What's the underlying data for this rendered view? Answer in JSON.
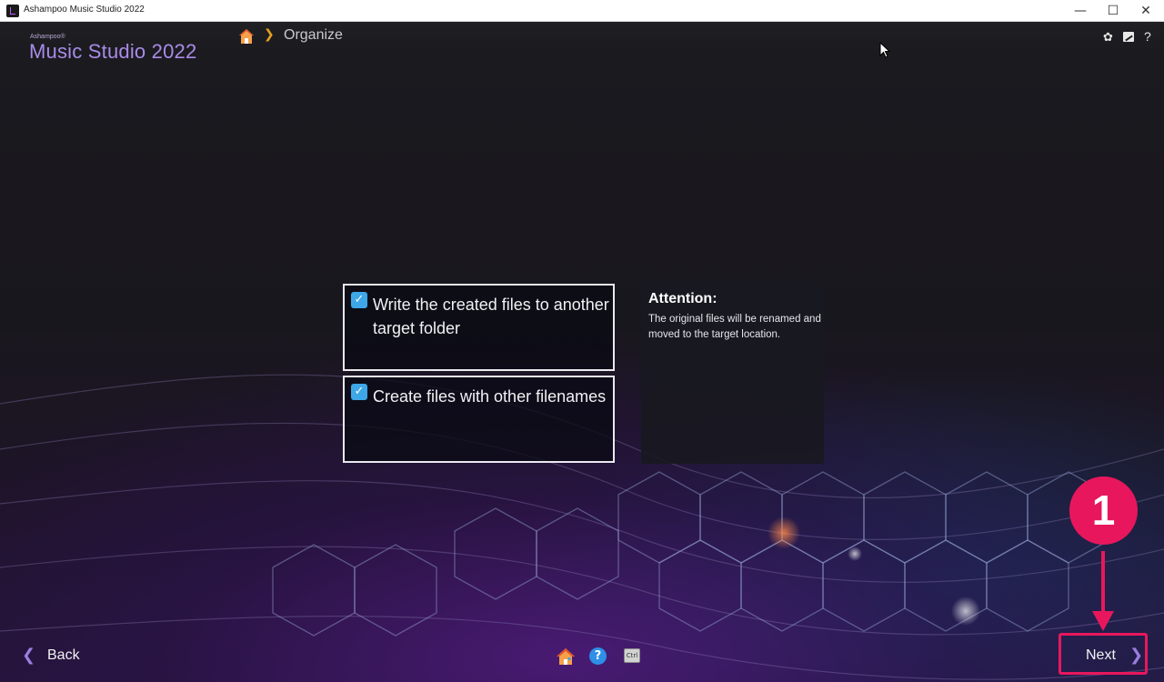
{
  "window": {
    "title": "Ashampoo Music Studio 2022",
    "minimize_glyph": "—",
    "maximize_glyph": "☐",
    "close_glyph": "✕"
  },
  "brand": {
    "small": "Ashampoo®",
    "main": "Music Studio 2022"
  },
  "breadcrumb": {
    "home_icon": "home-icon",
    "separator": "❯",
    "current": "Organize"
  },
  "top_right_icons": [
    "gear-icon",
    "edit-icon",
    "help-icon"
  ],
  "top_help_glyph": "?",
  "top_settings_glyph": "✿",
  "options": [
    {
      "label": "Write the created files to another target folder",
      "checked": true
    },
    {
      "label": "Create files with other filenames",
      "checked": true
    }
  ],
  "checkmark": "✓",
  "attention": {
    "title": "Attention:",
    "text": "The original files will be renamed and moved to the target location."
  },
  "footer": {
    "back_chevron": "❮",
    "back_label": "Back",
    "next_label": "Next",
    "next_chevron": "❯",
    "help_glyph": "?",
    "ctrl_label": "Ctrl"
  },
  "annotation": {
    "step_number": "1",
    "highlight_color": "#e8175d"
  },
  "colors": {
    "accent_purple": "#9b7ee0",
    "brand_purple": "#a98be8",
    "breadcrumb_chevron": "#e5a021",
    "checkbox_blue": "#3ea7e8"
  }
}
